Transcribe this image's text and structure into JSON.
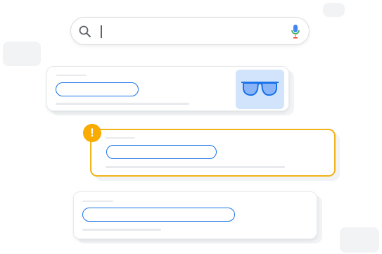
{
  "search": {
    "value": "",
    "icons": [
      "search-icon",
      "mic-icon"
    ]
  },
  "results": [
    {
      "id": "result-1",
      "state": "normal",
      "thumbnail_icon": "sunglasses-icon"
    },
    {
      "id": "result-2",
      "state": "warning",
      "badge": "!"
    },
    {
      "id": "result-3",
      "state": "normal"
    }
  ],
  "colors": {
    "accent_blue": "#1a73e8",
    "warning_yellow": "#f9ab00",
    "warning_border": "#f2b31a",
    "thumbnail_bg": "#d2e3fc",
    "placeholder_gray": "#e8eaed",
    "deco_gray": "#f1f3f4"
  }
}
